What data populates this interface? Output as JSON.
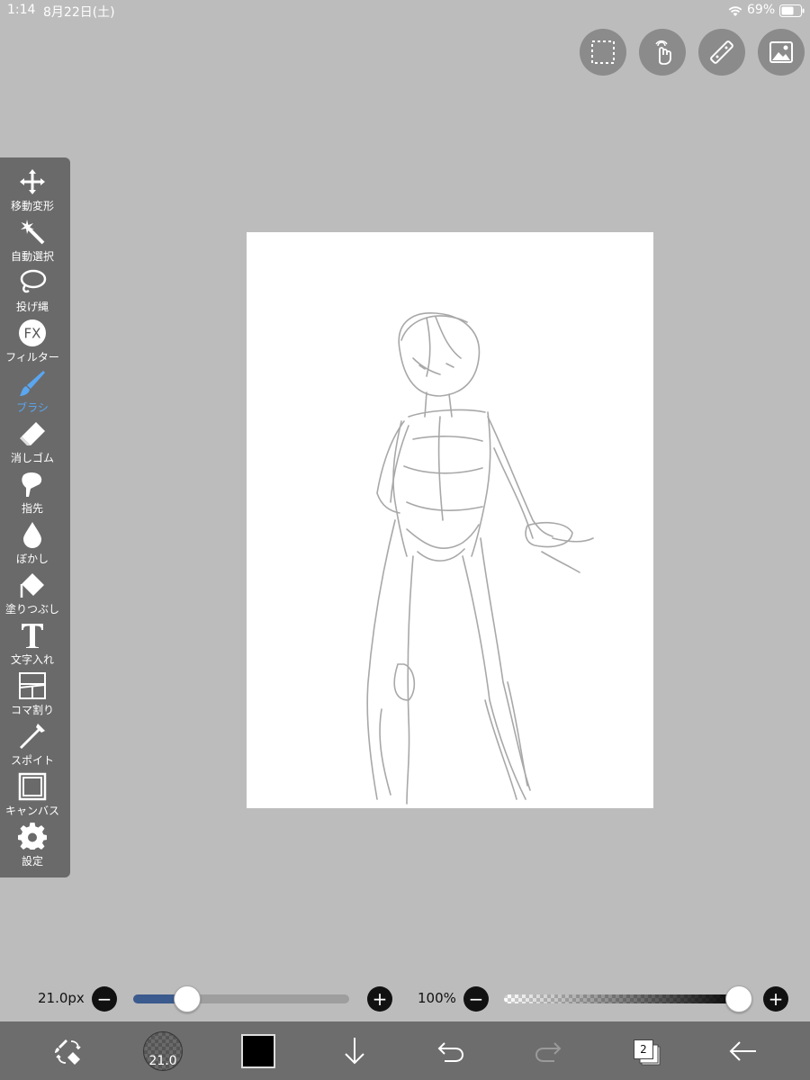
{
  "status": {
    "time": "1:14",
    "date": "8月22日(土)",
    "battery": "69%"
  },
  "top_actions": [
    {
      "name": "selection-icon"
    },
    {
      "name": "touch-icon"
    },
    {
      "name": "ruler-icon"
    },
    {
      "name": "image-icon"
    }
  ],
  "tools": [
    {
      "label": "移動変形",
      "icon": "move-icon"
    },
    {
      "label": "自動選択",
      "icon": "magic-wand-icon"
    },
    {
      "label": "投げ縄",
      "icon": "lasso-icon"
    },
    {
      "label": "FX",
      "sub": "フィルター",
      "icon": "fx-icon"
    },
    {
      "label": "ブラシ",
      "icon": "brush-icon",
      "active": true
    },
    {
      "label": "消しゴム",
      "icon": "eraser-icon"
    },
    {
      "label": "指先",
      "icon": "finger-icon"
    },
    {
      "label": "ぼかし",
      "icon": "blur-drop-icon"
    },
    {
      "label": "塗りつぶし",
      "icon": "fill-bucket-icon"
    },
    {
      "label": "文字入れ",
      "icon": "text-icon"
    },
    {
      "label": "コマ割り",
      "icon": "frame-divider-icon"
    },
    {
      "label": "スポイト",
      "icon": "eyedropper-icon"
    },
    {
      "label": "キャンバス",
      "icon": "canvas-icon"
    },
    {
      "label": "設定",
      "icon": "gear-icon"
    }
  ],
  "brush": {
    "size_label": "21.0px",
    "size_badge": "21.0",
    "size_level": 0.25
  },
  "opacity": {
    "label": "100%",
    "level": 1.0
  },
  "colors": {
    "background": "#bcbcbc",
    "toolbar": "#6a6a6a",
    "active_tool": "#5aa6f0",
    "size_track_fill": "#3b5a8e",
    "current_color": "#000000"
  },
  "bottom": {
    "layer_count": "2"
  }
}
